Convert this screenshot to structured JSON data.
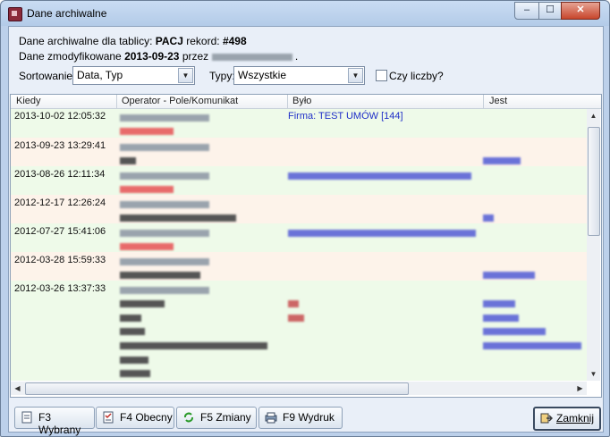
{
  "window": {
    "title": "Dane archiwalne",
    "min": "–",
    "max": "☐",
    "close": "✕"
  },
  "info": {
    "line1_prefix": "Dane archiwalne dla tablicy:",
    "table": "PACJ",
    "record_label": "rekord:",
    "record": "#498",
    "line2_prefix": "Dane zmodyfikowane",
    "date": "2013-09-23",
    "by": "przez",
    "dot": "."
  },
  "controls": {
    "sort_label": "Sortowanie:",
    "sort_value": "Data, Typ",
    "types_label": "Typy:",
    "types_value": "Wszystkie",
    "checkbox_label": "Czy liczby?"
  },
  "columns": [
    "Kiedy",
    "Operator - Pole/Komunikat",
    "Było",
    "Jest"
  ],
  "rows": [
    {
      "kiedy": "2013-10-02 12:05:32",
      "op": "",
      "bylo": "Firma: TEST UMÓW [144]",
      "jest": ""
    },
    {
      "kiedy": "",
      "op": "",
      "bylo": "",
      "jest": ""
    },
    {
      "kiedy": "2013-09-23 13:29:41",
      "op": "",
      "bylo": "",
      "jest": ""
    },
    {
      "kiedy": "",
      "op": "",
      "bylo": "",
      "jest": ""
    },
    {
      "kiedy": "2013-08-26 12:11:34",
      "op": "",
      "bylo": "",
      "jest": ""
    },
    {
      "kiedy": "",
      "op": "",
      "bylo": "",
      "jest": ""
    },
    {
      "kiedy": "2012-12-17 12:26:24",
      "op": "",
      "bylo": "",
      "jest": ""
    },
    {
      "kiedy": "",
      "op": "",
      "bylo": "",
      "jest": ""
    },
    {
      "kiedy": "2012-07-27 15:41:06",
      "op": "",
      "bylo": "",
      "jest": ""
    },
    {
      "kiedy": "",
      "op": "",
      "bylo": "",
      "jest": ""
    },
    {
      "kiedy": "2012-03-28 15:59:33",
      "op": "",
      "bylo": "",
      "jest": ""
    },
    {
      "kiedy": "",
      "op": "",
      "bylo": "",
      "jest": ""
    },
    {
      "kiedy": "2012-03-26 13:37:33",
      "op": "",
      "bylo": "",
      "jest": ""
    }
  ],
  "buttons": {
    "f3": "F3 Wybrany",
    "f4": "F4 Obecny",
    "f5": "F5 Zmiany",
    "f9": "F9 Wydruk",
    "close": "Zamknij"
  },
  "colors": {
    "row_green": "#eefae9",
    "row_peach": "#fdf3ea",
    "red_text": "#e03030",
    "blue_text": "#1f2fc8"
  }
}
